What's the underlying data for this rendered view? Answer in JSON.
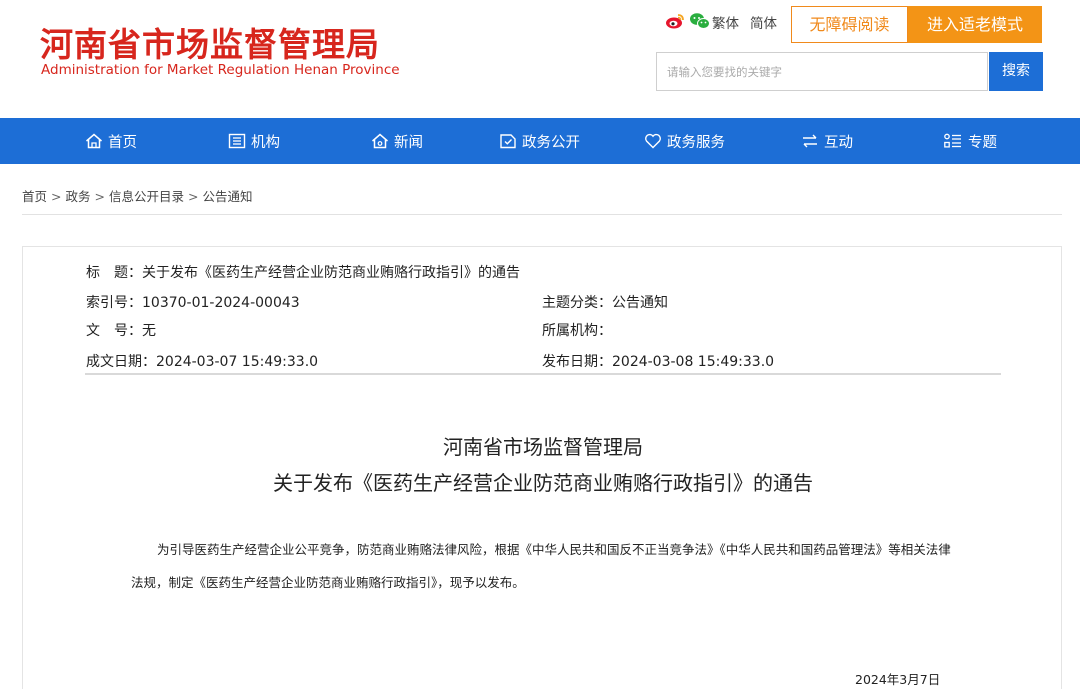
{
  "header": {
    "title_cn": "河南省市场监督管理局",
    "title_en": "Administration for Market Regulation Henan Province",
    "social_icons": [
      "weibo-icon",
      "wechat-icon"
    ],
    "lang_traditional": "繁体",
    "lang_simplified": "简体",
    "accessibility_label": "无障碍阅读",
    "elder_mode_label": "进入适老模式",
    "search_placeholder": "请输入您要找的关键字",
    "search_button": "搜索"
  },
  "nav": {
    "items": [
      {
        "label": "首页",
        "icon": "home-icon"
      },
      {
        "label": "机构",
        "icon": "organization-icon"
      },
      {
        "label": "新闻",
        "icon": "news-icon"
      },
      {
        "label": "政务公开",
        "icon": "open-government-icon"
      },
      {
        "label": "政务服务",
        "icon": "heart-icon"
      },
      {
        "label": "互动",
        "icon": "exchange-icon"
      },
      {
        "label": "专题",
        "icon": "topics-icon"
      }
    ]
  },
  "breadcrumb": {
    "items": [
      "首页",
      "政务",
      "信息公开目录",
      "公告通知"
    ],
    "separator": ">"
  },
  "meta": {
    "title_label": "标　题：",
    "title_value": "关于发布《医药生产经营企业防范商业贿赂行政指引》的通告",
    "index_label": "索引号：",
    "index_value": "10370-01-2024-00043",
    "category_label": "主题分类：",
    "category_value": "公告通知",
    "docno_label": "文　号：",
    "docno_value": "无",
    "org_label": "所属机构：",
    "org_value": "",
    "created_label": "成文日期：",
    "created_value": "2024-03-07 15:49:33.0",
    "published_label": "发布日期：",
    "published_value": "2024-03-08 15:49:33.0"
  },
  "document": {
    "heading_line1": "河南省市场监督管理局",
    "heading_line2": "关于发布《医药生产经营企业防范商业贿赂行政指引》的通告",
    "body": "为引导医药生产经营企业公平竞争，防范商业贿赂法律风险，根据《中华人民共和国反不正当竞争法》《中华人民共和国药品管理法》等相关法律法规，制定《医药生产经营企业防范商业贿赂行政指引》，现予以发布。",
    "date": "2024年3月7日"
  },
  "colors": {
    "brand_red": "#d7261d",
    "nav_blue": "#1d6ed6",
    "accent_orange": "#f39416"
  }
}
